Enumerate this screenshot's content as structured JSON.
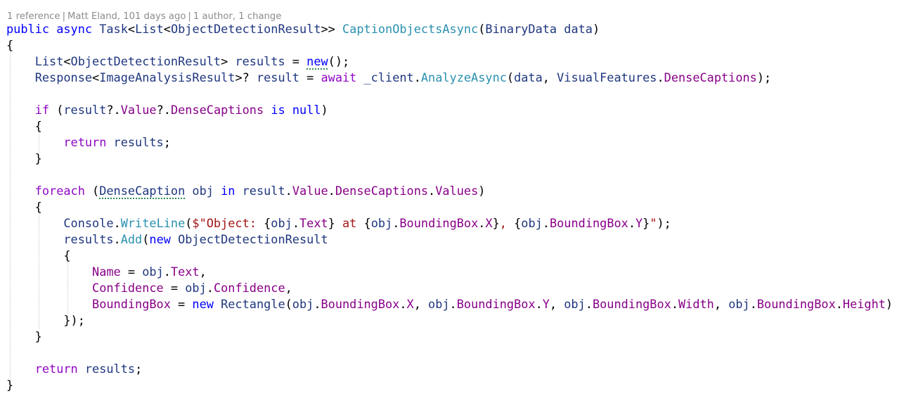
{
  "codelens": {
    "references": "1 reference",
    "author_info": "Matt Eland, 101 days ago",
    "changes": "1 author, 1 change",
    "separator": "|"
  },
  "colors": {
    "keyword": "#0000ff",
    "control_keyword": "#8f08c4",
    "type": "#2b91af",
    "method": "#74531f",
    "property": "#880088",
    "variable": "#1f377f",
    "string": "#a31515",
    "codelens_text": "#8c8c8c",
    "background": "#ffffff"
  },
  "code": [
    [
      [
        "kw",
        "public"
      ],
      [
        "pun",
        " "
      ],
      [
        "kw",
        "async"
      ],
      [
        "pun",
        " "
      ],
      [
        "var",
        "Task"
      ],
      [
        "pun",
        "<"
      ],
      [
        "var",
        "List"
      ],
      [
        "pun",
        "<"
      ],
      [
        "var",
        "ObjectDetectionResult"
      ],
      [
        "pun",
        ">> "
      ],
      [
        "typ",
        "CaptionObjectsAsync"
      ],
      [
        "pun",
        "("
      ],
      [
        "var",
        "BinaryData"
      ],
      [
        "pun",
        " "
      ],
      [
        "var",
        "data"
      ],
      [
        "pun",
        ")"
      ]
    ],
    [
      [
        "pun",
        "{"
      ]
    ],
    [
      [
        "pun",
        "    "
      ],
      [
        "var",
        "List"
      ],
      [
        "pun",
        "<"
      ],
      [
        "var",
        "ObjectDetectionResult"
      ],
      [
        "pun",
        "> "
      ],
      [
        "var",
        "results"
      ],
      [
        "pun",
        " = "
      ],
      [
        "kw",
        "new"
      ],
      [
        "pun",
        "();"
      ]
    ],
    [
      [
        "pun",
        "    "
      ],
      [
        "var",
        "Response"
      ],
      [
        "pun",
        "<"
      ],
      [
        "var",
        "ImageAnalysisResult"
      ],
      [
        "pun",
        ">? "
      ],
      [
        "var",
        "result"
      ],
      [
        "pun",
        " = "
      ],
      [
        "ctl",
        "await"
      ],
      [
        "pun",
        " "
      ],
      [
        "var",
        "_client"
      ],
      [
        "pun",
        "."
      ],
      [
        "typ",
        "AnalyzeAsync"
      ],
      [
        "pun",
        "("
      ],
      [
        "var",
        "data"
      ],
      [
        "pun",
        ", "
      ],
      [
        "var",
        "VisualFeatures"
      ],
      [
        "pun",
        "."
      ],
      [
        "prop",
        "DenseCaptions"
      ],
      [
        "pun",
        ");"
      ]
    ],
    [
      [
        "pun",
        ""
      ]
    ],
    [
      [
        "pun",
        "    "
      ],
      [
        "ctl",
        "if"
      ],
      [
        "pun",
        " ("
      ],
      [
        "var",
        "result"
      ],
      [
        "pun",
        "?."
      ],
      [
        "prop",
        "Value"
      ],
      [
        "pun",
        "?."
      ],
      [
        "prop",
        "DenseCaptions"
      ],
      [
        "pun",
        " "
      ],
      [
        "kw",
        "is"
      ],
      [
        "pun",
        " "
      ],
      [
        "kw",
        "null"
      ],
      [
        "pun",
        ")"
      ]
    ],
    [
      [
        "pun",
        "    {"
      ]
    ],
    [
      [
        "pun",
        "        "
      ],
      [
        "ctl",
        "return"
      ],
      [
        "pun",
        " "
      ],
      [
        "var",
        "results"
      ],
      [
        "pun",
        ";"
      ]
    ],
    [
      [
        "pun",
        "    }"
      ]
    ],
    [
      [
        "pun",
        ""
      ]
    ],
    [
      [
        "pun",
        "    "
      ],
      [
        "ctl",
        "foreach"
      ],
      [
        "pun",
        " ("
      ],
      [
        "var",
        "DenseCaption"
      ],
      [
        "pun",
        " "
      ],
      [
        "var",
        "obj"
      ],
      [
        "pun",
        " "
      ],
      [
        "kw",
        "in"
      ],
      [
        "pun",
        " "
      ],
      [
        "var",
        "result"
      ],
      [
        "pun",
        "."
      ],
      [
        "prop",
        "Value"
      ],
      [
        "pun",
        "."
      ],
      [
        "prop",
        "DenseCaptions"
      ],
      [
        "pun",
        "."
      ],
      [
        "prop",
        "Values"
      ],
      [
        "pun",
        ")"
      ]
    ],
    [
      [
        "pun",
        "    {"
      ]
    ],
    [
      [
        "pun",
        "        "
      ],
      [
        "var",
        "Console"
      ],
      [
        "pun",
        "."
      ],
      [
        "typ",
        "WriteLine"
      ],
      [
        "pun",
        "("
      ],
      [
        "str",
        "$\"Object: "
      ],
      [
        "pun",
        "{"
      ],
      [
        "var",
        "obj"
      ],
      [
        "pun",
        "."
      ],
      [
        "prop",
        "Text"
      ],
      [
        "pun",
        "}"
      ],
      [
        "str",
        " at "
      ],
      [
        "pun",
        "{"
      ],
      [
        "var",
        "obj"
      ],
      [
        "pun",
        "."
      ],
      [
        "prop",
        "BoundingBox"
      ],
      [
        "pun",
        "."
      ],
      [
        "prop",
        "X"
      ],
      [
        "pun",
        "}"
      ],
      [
        "str",
        ", "
      ],
      [
        "pun",
        "{"
      ],
      [
        "var",
        "obj"
      ],
      [
        "pun",
        "."
      ],
      [
        "prop",
        "BoundingBox"
      ],
      [
        "pun",
        "."
      ],
      [
        "prop",
        "Y"
      ],
      [
        "pun",
        "}"
      ],
      [
        "str",
        "\""
      ],
      [
        "pun",
        ");"
      ]
    ],
    [
      [
        "pun",
        "        "
      ],
      [
        "var",
        "results"
      ],
      [
        "pun",
        "."
      ],
      [
        "typ",
        "Add"
      ],
      [
        "pun",
        "("
      ],
      [
        "kw",
        "new"
      ],
      [
        "pun",
        " "
      ],
      [
        "var",
        "ObjectDetectionResult"
      ]
    ],
    [
      [
        "pun",
        "        {"
      ]
    ],
    [
      [
        "pun",
        "            "
      ],
      [
        "prop",
        "Name"
      ],
      [
        "pun",
        " = "
      ],
      [
        "var",
        "obj"
      ],
      [
        "pun",
        "."
      ],
      [
        "prop",
        "Text"
      ],
      [
        "pun",
        ","
      ]
    ],
    [
      [
        "pun",
        "            "
      ],
      [
        "prop",
        "Confidence"
      ],
      [
        "pun",
        " = "
      ],
      [
        "var",
        "obj"
      ],
      [
        "pun",
        "."
      ],
      [
        "prop",
        "Confidence"
      ],
      [
        "pun",
        ","
      ]
    ],
    [
      [
        "pun",
        "            "
      ],
      [
        "prop",
        "BoundingBox"
      ],
      [
        "pun",
        " = "
      ],
      [
        "kw",
        "new"
      ],
      [
        "pun",
        " "
      ],
      [
        "var",
        "Rectangle"
      ],
      [
        "pun",
        "("
      ],
      [
        "var",
        "obj"
      ],
      [
        "pun",
        "."
      ],
      [
        "prop",
        "BoundingBox"
      ],
      [
        "pun",
        "."
      ],
      [
        "prop",
        "X"
      ],
      [
        "pun",
        ", "
      ],
      [
        "var",
        "obj"
      ],
      [
        "pun",
        "."
      ],
      [
        "prop",
        "BoundingBox"
      ],
      [
        "pun",
        "."
      ],
      [
        "prop",
        "Y"
      ],
      [
        "pun",
        ", "
      ],
      [
        "var",
        "obj"
      ],
      [
        "pun",
        "."
      ],
      [
        "prop",
        "BoundingBox"
      ],
      [
        "pun",
        "."
      ],
      [
        "prop",
        "Width"
      ],
      [
        "pun",
        ", "
      ],
      [
        "var",
        "obj"
      ],
      [
        "pun",
        "."
      ],
      [
        "prop",
        "BoundingBox"
      ],
      [
        "pun",
        "."
      ],
      [
        "prop",
        "Height"
      ],
      [
        "pun",
        ")"
      ]
    ],
    [
      [
        "pun",
        "        });"
      ]
    ],
    [
      [
        "pun",
        "    }"
      ]
    ],
    [
      [
        "pun",
        ""
      ]
    ],
    [
      [
        "pun",
        "    "
      ],
      [
        "ctl",
        "return"
      ],
      [
        "pun",
        " "
      ],
      [
        "var",
        "results"
      ],
      [
        "pun",
        ";"
      ]
    ],
    [
      [
        "pun",
        "}"
      ]
    ]
  ]
}
